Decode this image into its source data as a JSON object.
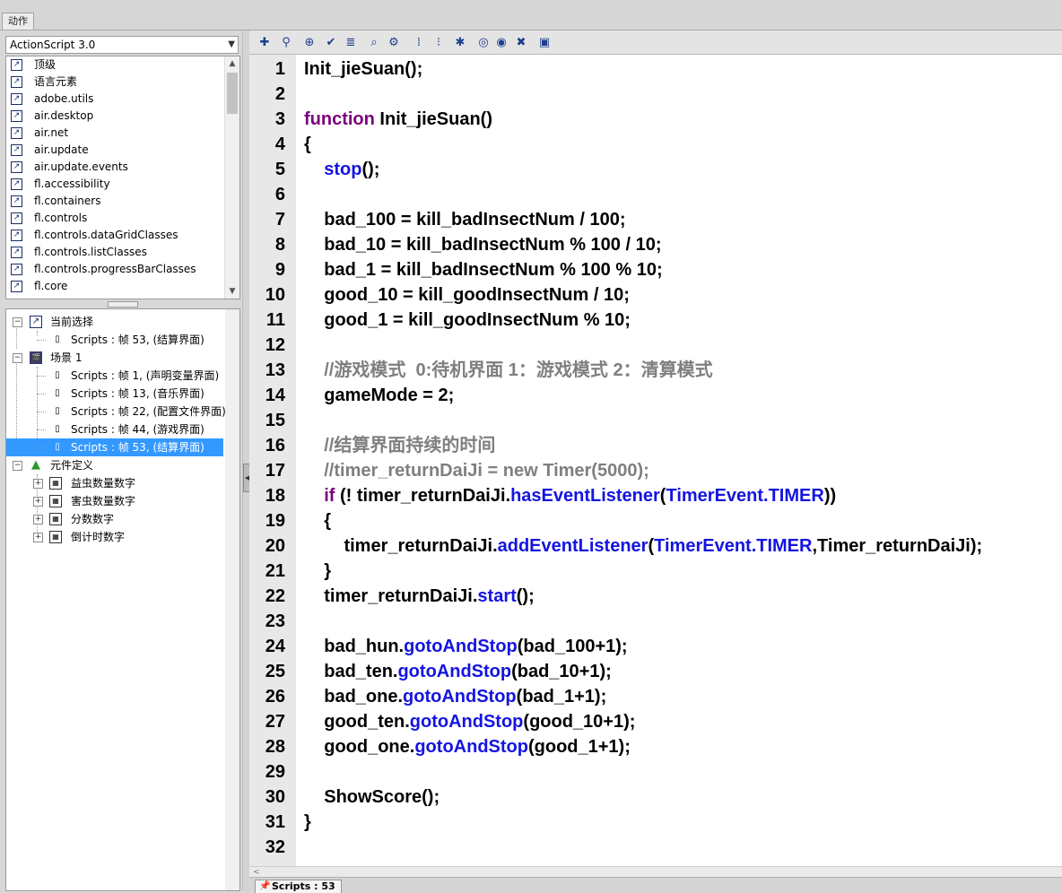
{
  "panel": {
    "tab_label": "动作"
  },
  "language_select": {
    "value": "ActionScript 3.0"
  },
  "toolbar": {
    "icons": [
      "add-statement-icon",
      "find-icon",
      "insert-target-path-icon",
      "check-syntax-icon",
      "auto-format-icon",
      "show-code-hint-icon",
      "debug-options-icon",
      "collapse-between-braces-icon",
      "collapse-selection-icon",
      "expand-all-icon",
      "apply-block-comment-icon",
      "apply-line-comment-icon",
      "remove-comment-icon",
      "show-hide-toolbox-icon"
    ]
  },
  "packages": [
    "顶级",
    "语言元素",
    "adobe.utils",
    "air.desktop",
    "air.net",
    "air.update",
    "air.update.events",
    "fl.accessibility",
    "fl.containers",
    "fl.controls",
    "fl.controls.dataGridClasses",
    "fl.controls.listClasses",
    "fl.controls.progressBarClasses",
    "fl.core"
  ],
  "tree": {
    "current_selection": "当前选择",
    "current_script": "Scripts : 帧 53, (结算界面)",
    "scene": "场景 1",
    "scene_scripts": [
      "Scripts : 帧 1, (声明变量界面)",
      "Scripts : 帧 13, (音乐界面)",
      "Scripts : 帧 22, (配置文件界面)",
      "Scripts : 帧 44, (游戏界面)",
      "Scripts : 帧 53, (结算界面)"
    ],
    "symbols_label": "元件定义",
    "symbols": [
      "益虫数量数字",
      "害虫数量数字",
      "分数数字",
      "倒计时数字"
    ]
  },
  "editor": {
    "lines": [
      [
        {
          "t": "Init_jieSuan();",
          "c": "p"
        }
      ],
      [],
      [
        {
          "t": "function",
          "c": "kw"
        },
        {
          "t": " Init_jieSuan()",
          "c": "p"
        }
      ],
      [
        {
          "t": "{",
          "c": "p"
        }
      ],
      [
        {
          "t": "    ",
          "c": "p"
        },
        {
          "t": "stop",
          "c": "fn"
        },
        {
          "t": "();",
          "c": "p"
        }
      ],
      [],
      [
        {
          "t": "    bad_100 = kill_badInsectNum / 100;",
          "c": "p"
        }
      ],
      [
        {
          "t": "    bad_10 = kill_badInsectNum % 100 / 10;",
          "c": "p"
        }
      ],
      [
        {
          "t": "    bad_1 = kill_badInsectNum % 100 % 10;",
          "c": "p"
        }
      ],
      [
        {
          "t": "    good_10 = kill_goodInsectNum / 10;",
          "c": "p"
        }
      ],
      [
        {
          "t": "    good_1 = kill_goodInsectNum % 10;",
          "c": "p"
        }
      ],
      [],
      [
        {
          "t": "    ",
          "c": "p"
        },
        {
          "t": "//游戏模式  0:待机界面 1：游戏模式 2：清算模式",
          "c": "cm"
        }
      ],
      [
        {
          "t": "    gameMode = 2;",
          "c": "p"
        }
      ],
      [],
      [
        {
          "t": "    ",
          "c": "p"
        },
        {
          "t": "//结算界面持续的时间",
          "c": "cm"
        }
      ],
      [
        {
          "t": "    ",
          "c": "p"
        },
        {
          "t": "//timer_returnDaiJi = new Timer(5000);",
          "c": "cm"
        }
      ],
      [
        {
          "t": "    ",
          "c": "p"
        },
        {
          "t": "if",
          "c": "kw"
        },
        {
          "t": " (! timer_returnDaiJi.",
          "c": "p"
        },
        {
          "t": "hasEventListener",
          "c": "fn"
        },
        {
          "t": "(",
          "c": "p"
        },
        {
          "t": "TimerEvent.TIMER",
          "c": "fn"
        },
        {
          "t": "))",
          "c": "p"
        }
      ],
      [
        {
          "t": "    {",
          "c": "p"
        }
      ],
      [
        {
          "t": "        timer_returnDaiJi.",
          "c": "p"
        },
        {
          "t": "addEventListener",
          "c": "fn"
        },
        {
          "t": "(",
          "c": "p"
        },
        {
          "t": "TimerEvent.TIMER",
          "c": "fn"
        },
        {
          "t": ",Timer_returnDaiJi);",
          "c": "p"
        }
      ],
      [
        {
          "t": "    }",
          "c": "p"
        }
      ],
      [
        {
          "t": "    timer_returnDaiJi.",
          "c": "p"
        },
        {
          "t": "start",
          "c": "fn"
        },
        {
          "t": "();",
          "c": "p"
        }
      ],
      [],
      [
        {
          "t": "    bad_hun.",
          "c": "p"
        },
        {
          "t": "gotoAndStop",
          "c": "fn"
        },
        {
          "t": "(bad_100+1);",
          "c": "p"
        }
      ],
      [
        {
          "t": "    bad_ten.",
          "c": "p"
        },
        {
          "t": "gotoAndStop",
          "c": "fn"
        },
        {
          "t": "(bad_10+1);",
          "c": "p"
        }
      ],
      [
        {
          "t": "    bad_one.",
          "c": "p"
        },
        {
          "t": "gotoAndStop",
          "c": "fn"
        },
        {
          "t": "(bad_1+1);",
          "c": "p"
        }
      ],
      [
        {
          "t": "    good_ten.",
          "c": "p"
        },
        {
          "t": "gotoAndStop",
          "c": "fn"
        },
        {
          "t": "(good_10+1);",
          "c": "p"
        }
      ],
      [
        {
          "t": "    good_one.",
          "c": "p"
        },
        {
          "t": "gotoAndStop",
          "c": "fn"
        },
        {
          "t": "(good_1+1);",
          "c": "p"
        }
      ],
      [],
      [
        {
          "t": "    ShowScore();",
          "c": "p"
        }
      ],
      [
        {
          "t": "}",
          "c": "p"
        }
      ],
      []
    ]
  },
  "status": {
    "script_tab": "Scripts : 53"
  },
  "colors": {
    "keyword": "#7a007a",
    "function": "#1414e0",
    "comment": "#7f7f7f",
    "selection": "#3399ff"
  }
}
